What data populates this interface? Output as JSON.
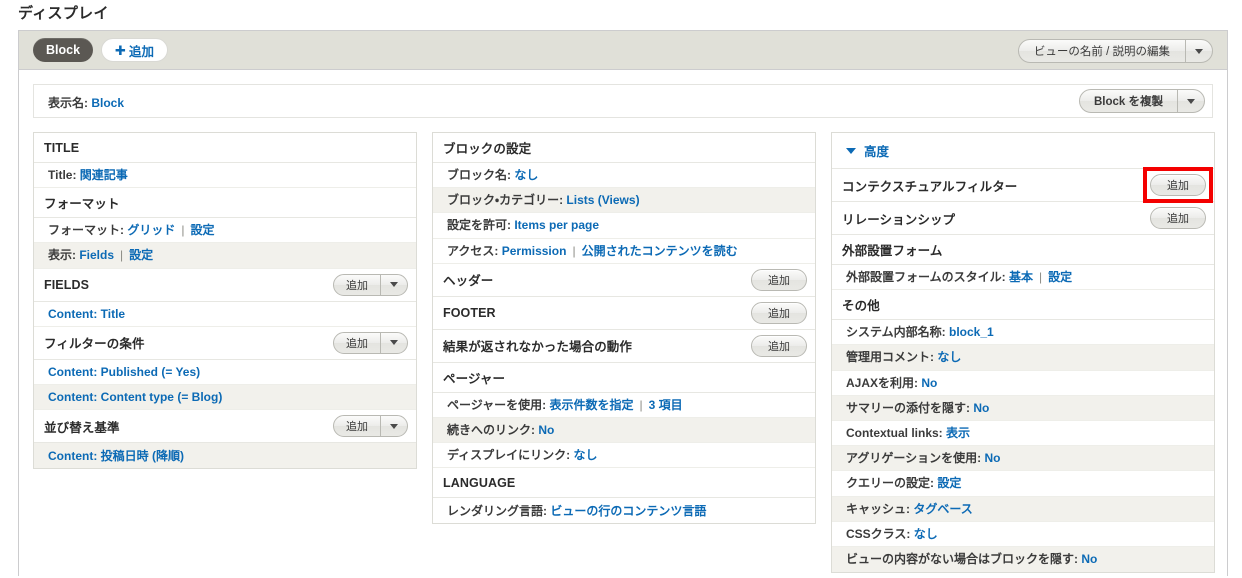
{
  "page": {
    "title": "ディスプレイ"
  },
  "display_tabs": {
    "active_tab": "Block",
    "add_tab": "追加",
    "add_icon": "plus-icon",
    "view_name_button": "ビューの名前 / 説明の編集",
    "view_name_caret": "chevron-down-icon"
  },
  "display_settings": {
    "display_name_label": "表示名:",
    "display_name_value": "Block",
    "duplicate_button": "Block を複製",
    "duplicate_caret": "chevron-down-icon"
  },
  "buttons": {
    "add": "追加",
    "caret": "chevron-down-icon"
  },
  "columns": {
    "left": [
      {
        "type": "header",
        "name": "bucket-title",
        "title": "TITLE",
        "button": null
      },
      {
        "type": "row",
        "name": "row-title",
        "alt": false,
        "label": "Title:",
        "links": [
          {
            "text": "関連記事"
          }
        ]
      },
      {
        "type": "header",
        "name": "bucket-format",
        "title": "フォーマット",
        "button": null
      },
      {
        "type": "row",
        "name": "row-format",
        "alt": false,
        "label": "フォーマット:",
        "links": [
          {
            "text": "グリッド"
          },
          {
            "text": "設定"
          }
        ]
      },
      {
        "type": "row",
        "name": "row-show",
        "alt": true,
        "label": "表示:",
        "links": [
          {
            "text": "Fields"
          },
          {
            "text": "設定"
          }
        ]
      },
      {
        "type": "header",
        "name": "bucket-fields",
        "title": "FIELDS",
        "button": "split"
      },
      {
        "type": "row",
        "name": "row-field-title",
        "alt": false,
        "label": null,
        "links": [
          {
            "text": "Content: Title"
          }
        ]
      },
      {
        "type": "header",
        "name": "bucket-filter-criteria",
        "title": "フィルターの条件",
        "button": "split"
      },
      {
        "type": "row",
        "name": "row-filter-published",
        "alt": false,
        "label": null,
        "links": [
          {
            "text": "Content: Published (= Yes)"
          }
        ]
      },
      {
        "type": "row",
        "name": "row-filter-content-type",
        "alt": true,
        "label": null,
        "links": [
          {
            "text": "Content: Content type (= Blog)"
          }
        ]
      },
      {
        "type": "header",
        "name": "bucket-sort-criteria",
        "title": "並び替え基準",
        "button": "split"
      },
      {
        "type": "row",
        "name": "row-sort-authored-on",
        "alt": true,
        "label": null,
        "links": [
          {
            "text": "Content: 投稿日時 (降順)"
          }
        ]
      }
    ],
    "middle": [
      {
        "type": "header",
        "name": "bucket-block-settings",
        "title": "ブロックの設定",
        "button": null
      },
      {
        "type": "row",
        "name": "row-block-name",
        "alt": false,
        "label": "ブロック名:",
        "links": [
          {
            "text": "なし"
          }
        ]
      },
      {
        "type": "row",
        "name": "row-block-category",
        "alt": true,
        "label": "ブロック・カテゴリー:",
        "links": [
          {
            "text": "Lists (Views)"
          }
        ]
      },
      {
        "type": "row",
        "name": "row-allow-settings",
        "alt": false,
        "label": "設定を許可:",
        "links": [
          {
            "text": "Items per page"
          }
        ]
      },
      {
        "type": "row",
        "name": "row-access",
        "alt": false,
        "label": "アクセス:",
        "links": [
          {
            "text": "Permission"
          },
          {
            "text": "公開されたコンテンツを読む"
          }
        ]
      },
      {
        "type": "header",
        "name": "bucket-header",
        "title": "ヘッダー",
        "button": "plain"
      },
      {
        "type": "header",
        "name": "bucket-footer",
        "title": "FOOTER",
        "button": "plain"
      },
      {
        "type": "header",
        "name": "bucket-no-results-behavior",
        "title": "結果が返されなかった場合の動作",
        "button": "plain"
      },
      {
        "type": "header",
        "name": "bucket-pager",
        "title": "ページャー",
        "button": null
      },
      {
        "type": "row",
        "name": "row-use-pager",
        "alt": false,
        "label": "ページャーを使用:",
        "links": [
          {
            "text": "表示件数を指定"
          },
          {
            "text": "3 項目"
          }
        ]
      },
      {
        "type": "row",
        "name": "row-more-link",
        "alt": true,
        "label": "続きへのリンク:",
        "links": [
          {
            "text": "No"
          }
        ]
      },
      {
        "type": "row",
        "name": "row-link-display",
        "alt": false,
        "label": "ディスプレイにリンク:",
        "links": [
          {
            "text": "なし"
          }
        ]
      },
      {
        "type": "header",
        "name": "bucket-language",
        "title": "LANGUAGE",
        "button": null
      },
      {
        "type": "row",
        "name": "row-rendering-language",
        "alt": false,
        "label": "レンダリング言語:",
        "links": [
          {
            "text": "ビューの行のコンテンツ言語"
          }
        ]
      }
    ],
    "right": [
      {
        "type": "advanced",
        "name": "advanced-toggle",
        "title": "高度",
        "icon": "triangle-down-icon"
      },
      {
        "type": "header",
        "name": "bucket-contextual-filters",
        "title": "コンテクスチュアルフィルター",
        "button": "plain",
        "highlighted": true
      },
      {
        "type": "header",
        "name": "bucket-relationships",
        "title": "リレーションシップ",
        "button": "plain"
      },
      {
        "type": "header",
        "name": "bucket-exposed-form",
        "title": "外部設置フォーム",
        "button": null
      },
      {
        "type": "row",
        "name": "row-exposed-form-style",
        "alt": false,
        "label": "外部設置フォームのスタイル:",
        "links": [
          {
            "text": "基本"
          },
          {
            "text": "設定"
          }
        ]
      },
      {
        "type": "header",
        "name": "bucket-other",
        "title": "その他",
        "button": null
      },
      {
        "type": "row",
        "name": "row-machine-name",
        "alt": false,
        "label": "システム内部名称:",
        "links": [
          {
            "text": "block_1"
          }
        ]
      },
      {
        "type": "row",
        "name": "row-admin-comment",
        "alt": true,
        "label": "管理用コメント:",
        "links": [
          {
            "text": "なし"
          }
        ]
      },
      {
        "type": "row",
        "name": "row-use-ajax",
        "alt": false,
        "label": "AJAXを利用:",
        "links": [
          {
            "text": "No"
          }
        ]
      },
      {
        "type": "row",
        "name": "row-hide-attachment-summary",
        "alt": true,
        "label": "サマリーの添付を隠す:",
        "links": [
          {
            "text": "No"
          }
        ]
      },
      {
        "type": "row",
        "name": "row-contextual-links",
        "alt": false,
        "label": "Contextual links:",
        "links": [
          {
            "text": "表示"
          }
        ]
      },
      {
        "type": "row",
        "name": "row-use-aggregation",
        "alt": true,
        "label": "アグリゲーションを使用:",
        "links": [
          {
            "text": "No"
          }
        ]
      },
      {
        "type": "row",
        "name": "row-query-settings",
        "alt": false,
        "label": "クエリーの設定:",
        "links": [
          {
            "text": "設定"
          }
        ]
      },
      {
        "type": "row",
        "name": "row-caching",
        "alt": true,
        "label": "キャッシュ:",
        "links": [
          {
            "text": "タグベース"
          }
        ]
      },
      {
        "type": "row",
        "name": "row-css-class",
        "alt": false,
        "label": "CSSクラス:",
        "links": [
          {
            "text": "なし"
          }
        ]
      },
      {
        "type": "row",
        "name": "row-hide-block-if-empty",
        "alt": true,
        "label": "ビューの内容がない場合はブロックを隠す:",
        "links": [
          {
            "text": "No"
          }
        ]
      }
    ]
  },
  "colors": {
    "link": "#0c6ab5",
    "tab_active_bg": "#5b5853",
    "tabbar_bg": "#e0e0d8",
    "row_alt_bg": "#f2f1ec",
    "highlight": "#f40000"
  }
}
